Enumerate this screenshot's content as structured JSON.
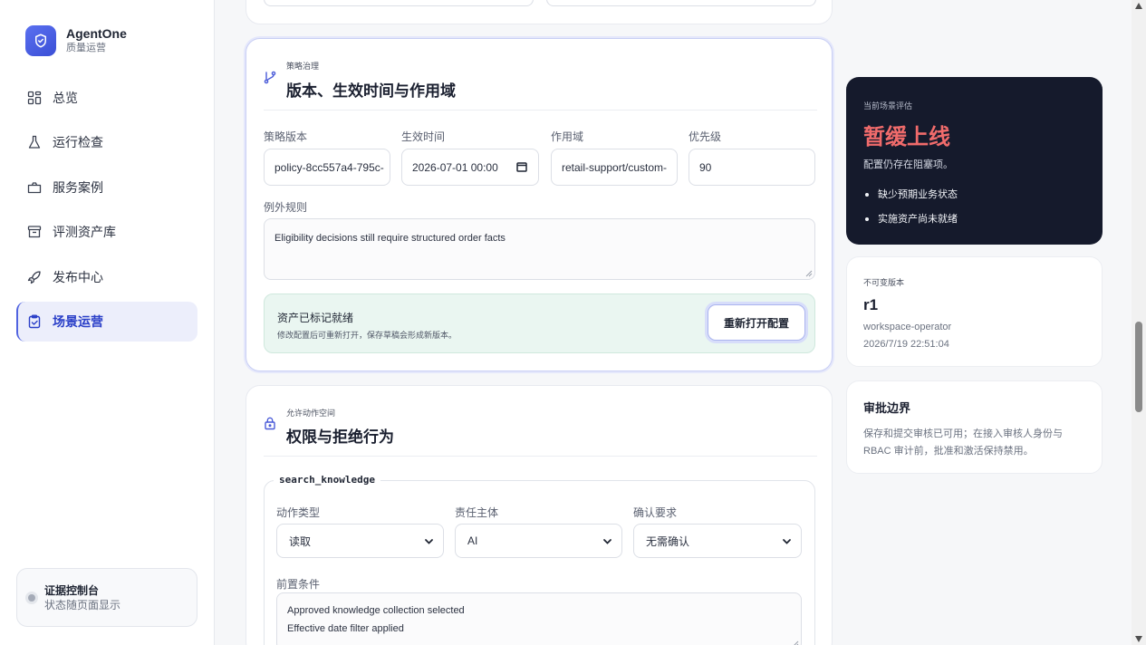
{
  "brand": {
    "name": "AgentOne",
    "subtitle": "质量运营"
  },
  "nav": [
    {
      "label": "总览",
      "icon": "dashboard-icon"
    },
    {
      "label": "运行检查",
      "icon": "flask-icon"
    },
    {
      "label": "服务案例",
      "icon": "briefcase-icon"
    },
    {
      "label": "评测资产库",
      "icon": "archive-icon"
    },
    {
      "label": "发布中心",
      "icon": "rocket-icon"
    },
    {
      "label": "场景运营",
      "icon": "clipboard-check-icon",
      "active": true
    }
  ],
  "evidence": {
    "title": "证据控制台",
    "subtitle": "状态随页面显示"
  },
  "governance": {
    "eyebrow": "策略治理",
    "title": "版本、生效时间与作用域",
    "fields": {
      "version_label": "策略版本",
      "version_value": "policy-8cc557a4-795c-",
      "effective_label": "生效时间",
      "effective_value": "2026-07-01 00:00",
      "scope_label": "作用域",
      "scope_value": "retail-support/custom-",
      "priority_label": "优先级",
      "priority_value": "90"
    },
    "exceptions_label": "例外规则",
    "exceptions_value": "Eligibility decisions still require structured order facts",
    "banner": {
      "title": "资产已标记就绪",
      "subtitle": "修改配置后可重新打开，保存草稿会形成新版本。",
      "button": "重新打开配置"
    }
  },
  "permissions": {
    "eyebrow": "允许动作空间",
    "title": "权限与拒绝行为",
    "action": {
      "name": "search_knowledge",
      "type_label": "动作类型",
      "type_value": "读取",
      "owner_label": "责任主体",
      "owner_value": "AI",
      "confirm_label": "确认要求",
      "confirm_value": "无需确认",
      "precondition_label": "前置条件",
      "preconditions": [
        "Approved knowledge collection selected",
        "Effective date filter applied"
      ]
    }
  },
  "evaluation": {
    "eyebrow": "当前场景评估",
    "verdict": "暂缓上线",
    "summary": "配置仍存在阻塞项。",
    "blockers": [
      "缺少预期业务状态",
      "实施资产尚未就绪"
    ],
    "verdict_color": "#f06b6b"
  },
  "immutable": {
    "eyebrow": "不可变版本",
    "revision": "r1",
    "author": "workspace-operator",
    "timestamp": "2026/7/19 22:51:04"
  },
  "approval": {
    "title": "审批边界",
    "body": "保存和提交审核已可用；在接入审核人身份与 RBAC 审计前，批准和激活保持禁用。"
  }
}
